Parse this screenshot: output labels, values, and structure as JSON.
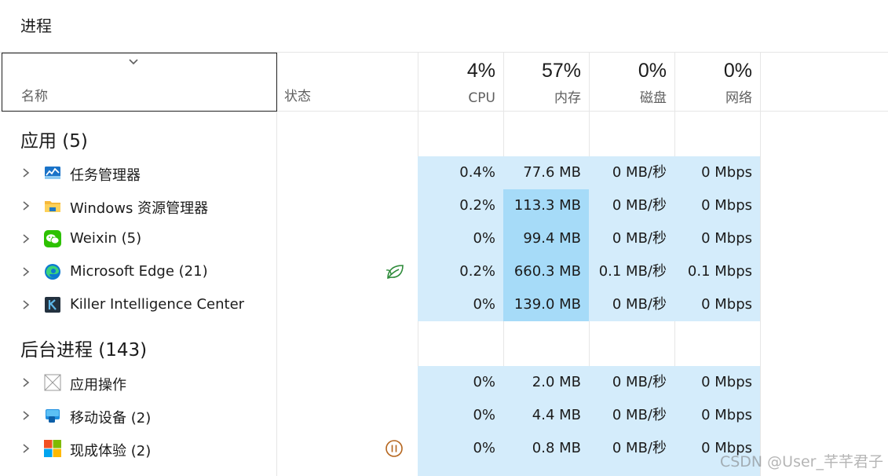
{
  "page": {
    "title": "进程"
  },
  "header": {
    "name_label": "名称",
    "status_label": "状态",
    "cpu": {
      "pct": "4%",
      "label": "CPU"
    },
    "memory": {
      "pct": "57%",
      "label": "内存"
    },
    "disk": {
      "pct": "0%",
      "label": "磁盘"
    },
    "network": {
      "pct": "0%",
      "label": "网络"
    },
    "sort_icon": "chevron-down-icon"
  },
  "groups": {
    "apps": {
      "title": "应用 (5)",
      "rows": [
        {
          "name": "任务管理器",
          "icon": "task-manager-icon",
          "status": "",
          "cpu": "0.4%",
          "mem": "77.6 MB",
          "disk": "0 MB/秒",
          "net": "0 Mbps",
          "mem_level": "light"
        },
        {
          "name": "Windows 资源管理器",
          "icon": "folder-icon",
          "status": "",
          "cpu": "0.2%",
          "mem": "113.3 MB",
          "disk": "0 MB/秒",
          "net": "0 Mbps",
          "mem_level": "mid"
        },
        {
          "name": "Weixin (5)",
          "icon": "wechat-icon",
          "status": "",
          "cpu": "0%",
          "mem": "99.4 MB",
          "disk": "0 MB/秒",
          "net": "0 Mbps",
          "mem_level": "mid"
        },
        {
          "name": "Microsoft Edge (21)",
          "icon": "edge-icon",
          "status": "efficiency-leaf-icon",
          "cpu": "0.2%",
          "mem": "660.3 MB",
          "disk": "0.1 MB/秒",
          "net": "0.1 Mbps",
          "mem_level": "mid"
        },
        {
          "name": "Killer Intelligence Center",
          "icon": "killer-icon",
          "status": "",
          "cpu": "0%",
          "mem": "139.0 MB",
          "disk": "0 MB/秒",
          "net": "0 Mbps",
          "mem_level": "mid"
        }
      ]
    },
    "background": {
      "title": "后台进程 (143)",
      "rows": [
        {
          "name": "应用操作",
          "icon": "app-actions-icon",
          "status": "",
          "cpu": "0%",
          "mem": "2.0 MB",
          "disk": "0 MB/秒",
          "net": "0 Mbps",
          "mem_level": "light"
        },
        {
          "name": "移动设备 (2)",
          "icon": "mobile-device-icon",
          "status": "",
          "cpu": "0%",
          "mem": "4.4 MB",
          "disk": "0 MB/秒",
          "net": "0 Mbps",
          "mem_level": "light"
        },
        {
          "name": "现成体验 (2)",
          "icon": "microsoft-logo-icon",
          "status": "suspended-icon",
          "cpu": "0%",
          "mem": "0.8 MB",
          "disk": "0 MB/秒",
          "net": "0 Mbps",
          "mem_level": "light"
        }
      ]
    }
  },
  "colors": {
    "heat_light": "#d4ecfb",
    "heat_mid": "#a6dbf8",
    "efficiency_green": "#2e8b3a",
    "suspended_orange": "#b5651d"
  },
  "watermark": "CSDN @User_芊芊君子"
}
